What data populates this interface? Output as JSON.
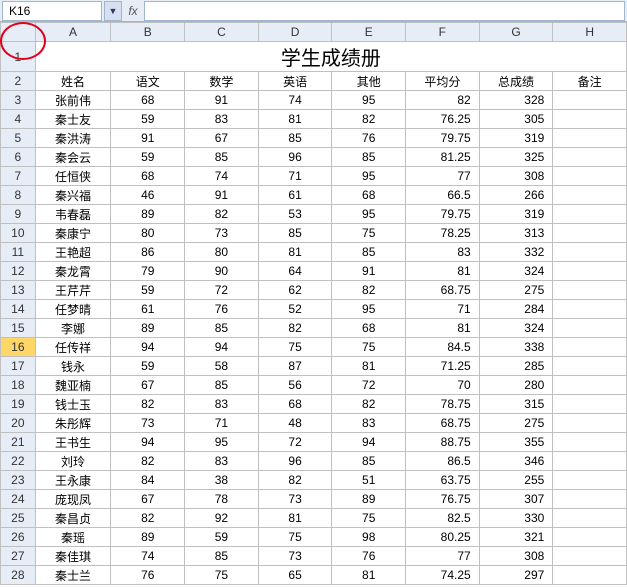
{
  "formula_bar": {
    "cell_ref": "K16",
    "fx_symbol": "fx",
    "formula_value": ""
  },
  "columns": [
    "A",
    "B",
    "C",
    "D",
    "E",
    "F",
    "G",
    "H"
  ],
  "title_row": {
    "row_num": "1",
    "title": "学生成绩册"
  },
  "header_row": {
    "row_num": "2",
    "cells": [
      "姓名",
      "语文",
      "数学",
      "英语",
      "其他",
      "平均分",
      "总成绩",
      "备注"
    ]
  },
  "selected_row_index": 16,
  "rows": [
    {
      "n": "3",
      "c": [
        "张前伟",
        "68",
        "91",
        "74",
        "95",
        "82",
        "328",
        ""
      ]
    },
    {
      "n": "4",
      "c": [
        "秦士友",
        "59",
        "83",
        "81",
        "82",
        "76.25",
        "305",
        ""
      ]
    },
    {
      "n": "5",
      "c": [
        "秦洪涛",
        "91",
        "67",
        "85",
        "76",
        "79.75",
        "319",
        ""
      ]
    },
    {
      "n": "6",
      "c": [
        "秦会云",
        "59",
        "85",
        "96",
        "85",
        "81.25",
        "325",
        ""
      ]
    },
    {
      "n": "7",
      "c": [
        "任恒侠",
        "68",
        "74",
        "71",
        "95",
        "77",
        "308",
        ""
      ]
    },
    {
      "n": "8",
      "c": [
        "秦兴福",
        "46",
        "91",
        "61",
        "68",
        "66.5",
        "266",
        ""
      ]
    },
    {
      "n": "9",
      "c": [
        "韦春磊",
        "89",
        "82",
        "53",
        "95",
        "79.75",
        "319",
        ""
      ]
    },
    {
      "n": "10",
      "c": [
        "秦康宁",
        "80",
        "73",
        "85",
        "75",
        "78.25",
        "313",
        ""
      ]
    },
    {
      "n": "11",
      "c": [
        "王艳超",
        "86",
        "80",
        "81",
        "85",
        "83",
        "332",
        ""
      ]
    },
    {
      "n": "12",
      "c": [
        "秦龙霄",
        "79",
        "90",
        "64",
        "91",
        "81",
        "324",
        ""
      ]
    },
    {
      "n": "13",
      "c": [
        "王芹芹",
        "59",
        "72",
        "62",
        "82",
        "68.75",
        "275",
        ""
      ]
    },
    {
      "n": "14",
      "c": [
        "任梦晴",
        "61",
        "76",
        "52",
        "95",
        "71",
        "284",
        ""
      ]
    },
    {
      "n": "15",
      "c": [
        "李娜",
        "89",
        "85",
        "82",
        "68",
        "81",
        "324",
        ""
      ]
    },
    {
      "n": "16",
      "c": [
        "任传祥",
        "94",
        "94",
        "75",
        "75",
        "84.5",
        "338",
        ""
      ]
    },
    {
      "n": "17",
      "c": [
        "钱永",
        "59",
        "58",
        "87",
        "81",
        "71.25",
        "285",
        ""
      ]
    },
    {
      "n": "18",
      "c": [
        "魏亚楠",
        "67",
        "85",
        "56",
        "72",
        "70",
        "280",
        ""
      ]
    },
    {
      "n": "19",
      "c": [
        "钱士玉",
        "82",
        "83",
        "68",
        "82",
        "78.75",
        "315",
        ""
      ]
    },
    {
      "n": "20",
      "c": [
        "朱彤辉",
        "73",
        "71",
        "48",
        "83",
        "68.75",
        "275",
        ""
      ]
    },
    {
      "n": "21",
      "c": [
        "王书生",
        "94",
        "95",
        "72",
        "94",
        "88.75",
        "355",
        ""
      ]
    },
    {
      "n": "22",
      "c": [
        "刘玲",
        "82",
        "83",
        "96",
        "85",
        "86.5",
        "346",
        ""
      ]
    },
    {
      "n": "23",
      "c": [
        "王永康",
        "84",
        "38",
        "82",
        "51",
        "63.75",
        "255",
        ""
      ]
    },
    {
      "n": "24",
      "c": [
        "庞现凤",
        "67",
        "78",
        "73",
        "89",
        "76.75",
        "307",
        ""
      ]
    },
    {
      "n": "25",
      "c": [
        "秦昌贞",
        "82",
        "92",
        "81",
        "75",
        "82.5",
        "330",
        ""
      ]
    },
    {
      "n": "26",
      "c": [
        "秦瑶",
        "89",
        "59",
        "75",
        "98",
        "80.25",
        "321",
        ""
      ]
    },
    {
      "n": "27",
      "c": [
        "秦佳琪",
        "74",
        "85",
        "73",
        "76",
        "77",
        "308",
        ""
      ]
    },
    {
      "n": "28",
      "c": [
        "秦士兰",
        "76",
        "75",
        "65",
        "81",
        "74.25",
        "297",
        ""
      ]
    }
  ],
  "chart_data": {
    "type": "table",
    "title": "学生成绩册",
    "columns": [
      "姓名",
      "语文",
      "数学",
      "英语",
      "其他",
      "平均分",
      "总成绩",
      "备注"
    ],
    "data": [
      [
        "张前伟",
        68,
        91,
        74,
        95,
        82,
        328,
        null
      ],
      [
        "秦士友",
        59,
        83,
        81,
        82,
        76.25,
        305,
        null
      ],
      [
        "秦洪涛",
        91,
        67,
        85,
        76,
        79.75,
        319,
        null
      ],
      [
        "秦会云",
        59,
        85,
        96,
        85,
        81.25,
        325,
        null
      ],
      [
        "任恒侠",
        68,
        74,
        71,
        95,
        77,
        308,
        null
      ],
      [
        "秦兴福",
        46,
        91,
        61,
        68,
        66.5,
        266,
        null
      ],
      [
        "韦春磊",
        89,
        82,
        53,
        95,
        79.75,
        319,
        null
      ],
      [
        "秦康宁",
        80,
        73,
        85,
        75,
        78.25,
        313,
        null
      ],
      [
        "王艳超",
        86,
        80,
        81,
        85,
        83,
        332,
        null
      ],
      [
        "秦龙霄",
        79,
        90,
        64,
        91,
        81,
        324,
        null
      ],
      [
        "王芹芹",
        59,
        72,
        62,
        82,
        68.75,
        275,
        null
      ],
      [
        "任梦晴",
        61,
        76,
        52,
        95,
        71,
        284,
        null
      ],
      [
        "李娜",
        89,
        85,
        82,
        68,
        81,
        324,
        null
      ],
      [
        "任传祥",
        94,
        94,
        75,
        75,
        84.5,
        338,
        null
      ],
      [
        "钱永",
        59,
        58,
        87,
        81,
        71.25,
        285,
        null
      ],
      [
        "魏亚楠",
        67,
        85,
        56,
        72,
        70,
        280,
        null
      ],
      [
        "钱士玉",
        82,
        83,
        68,
        82,
        78.75,
        315,
        null
      ],
      [
        "朱彤辉",
        73,
        71,
        48,
        83,
        68.75,
        275,
        null
      ],
      [
        "王书生",
        94,
        95,
        72,
        94,
        88.75,
        355,
        null
      ],
      [
        "刘玲",
        82,
        83,
        96,
        85,
        86.5,
        346,
        null
      ],
      [
        "王永康",
        84,
        38,
        82,
        51,
        63.75,
        255,
        null
      ],
      [
        "庞现凤",
        67,
        78,
        73,
        89,
        76.75,
        307,
        null
      ],
      [
        "秦昌贞",
        82,
        92,
        81,
        75,
        82.5,
        330,
        null
      ],
      [
        "秦瑶",
        89,
        59,
        75,
        98,
        80.25,
        321,
        null
      ],
      [
        "秦佳琪",
        74,
        85,
        73,
        76,
        77,
        308,
        null
      ],
      [
        "秦士兰",
        76,
        75,
        65,
        81,
        74.25,
        297,
        null
      ]
    ]
  }
}
